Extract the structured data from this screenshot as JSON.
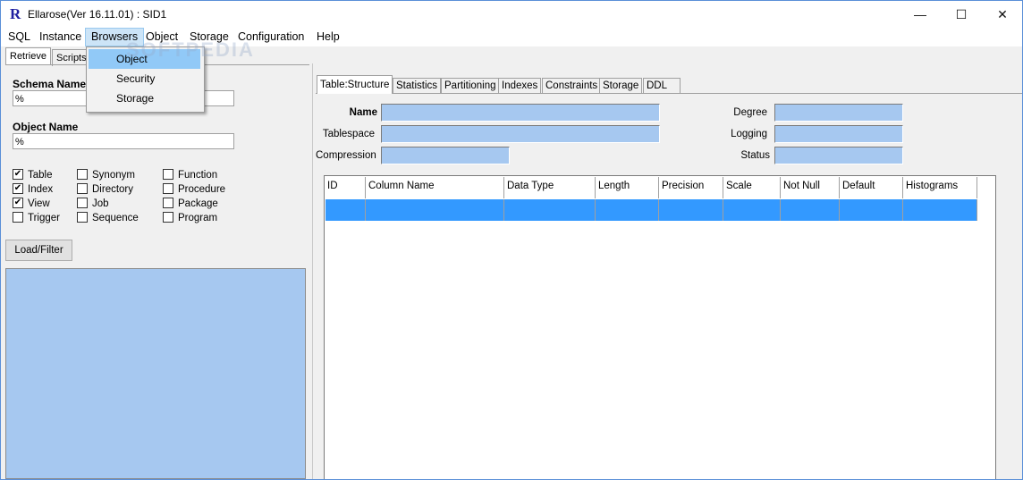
{
  "window": {
    "icon_letter": "R",
    "title": "Ellarose(Ver 16.11.01) : SID1",
    "controls": {
      "minimize": "—",
      "maximize": "☐",
      "close": "✕"
    }
  },
  "menubar": [
    "SQL",
    "Instance",
    "Browsers",
    "Object",
    "Storage",
    "Configuration",
    "Help"
  ],
  "dropdown": [
    "Object",
    "Security",
    "Storage"
  ],
  "watermark": "SOFTPEDIA",
  "left_panel": {
    "tabs": [
      "Retrieve",
      "Scripts"
    ],
    "schema_label": "Schema Name",
    "schema_value": "%",
    "object_label": "Object Name",
    "object_value": "%",
    "checkboxes": [
      {
        "label": "Table",
        "checked": true
      },
      {
        "label": "Index",
        "checked": true
      },
      {
        "label": "View",
        "checked": true
      },
      {
        "label": "Trigger",
        "checked": false
      },
      {
        "label": "Synonym",
        "checked": false
      },
      {
        "label": "Directory",
        "checked": false
      },
      {
        "label": "Job",
        "checked": false
      },
      {
        "label": "Sequence",
        "checked": false
      },
      {
        "label": "Function",
        "checked": false
      },
      {
        "label": "Procedure",
        "checked": false
      },
      {
        "label": "Package",
        "checked": false
      },
      {
        "label": "Program",
        "checked": false
      }
    ],
    "load_button": "Load/Filter"
  },
  "right_panel": {
    "tabs": [
      "Table:Structure",
      "Statistics",
      "Partitioning",
      "Indexes",
      "Constraints",
      "Storage",
      "DDL"
    ],
    "fields_left": [
      "Name",
      "Tablespace",
      "Compression"
    ],
    "fields_right": [
      "Degree",
      "Logging",
      "Status"
    ],
    "columns": [
      "ID",
      "Column Name",
      "Data Type",
      "Length",
      "Precision",
      "Scale",
      "Not Null",
      "Default",
      "Histograms"
    ]
  }
}
